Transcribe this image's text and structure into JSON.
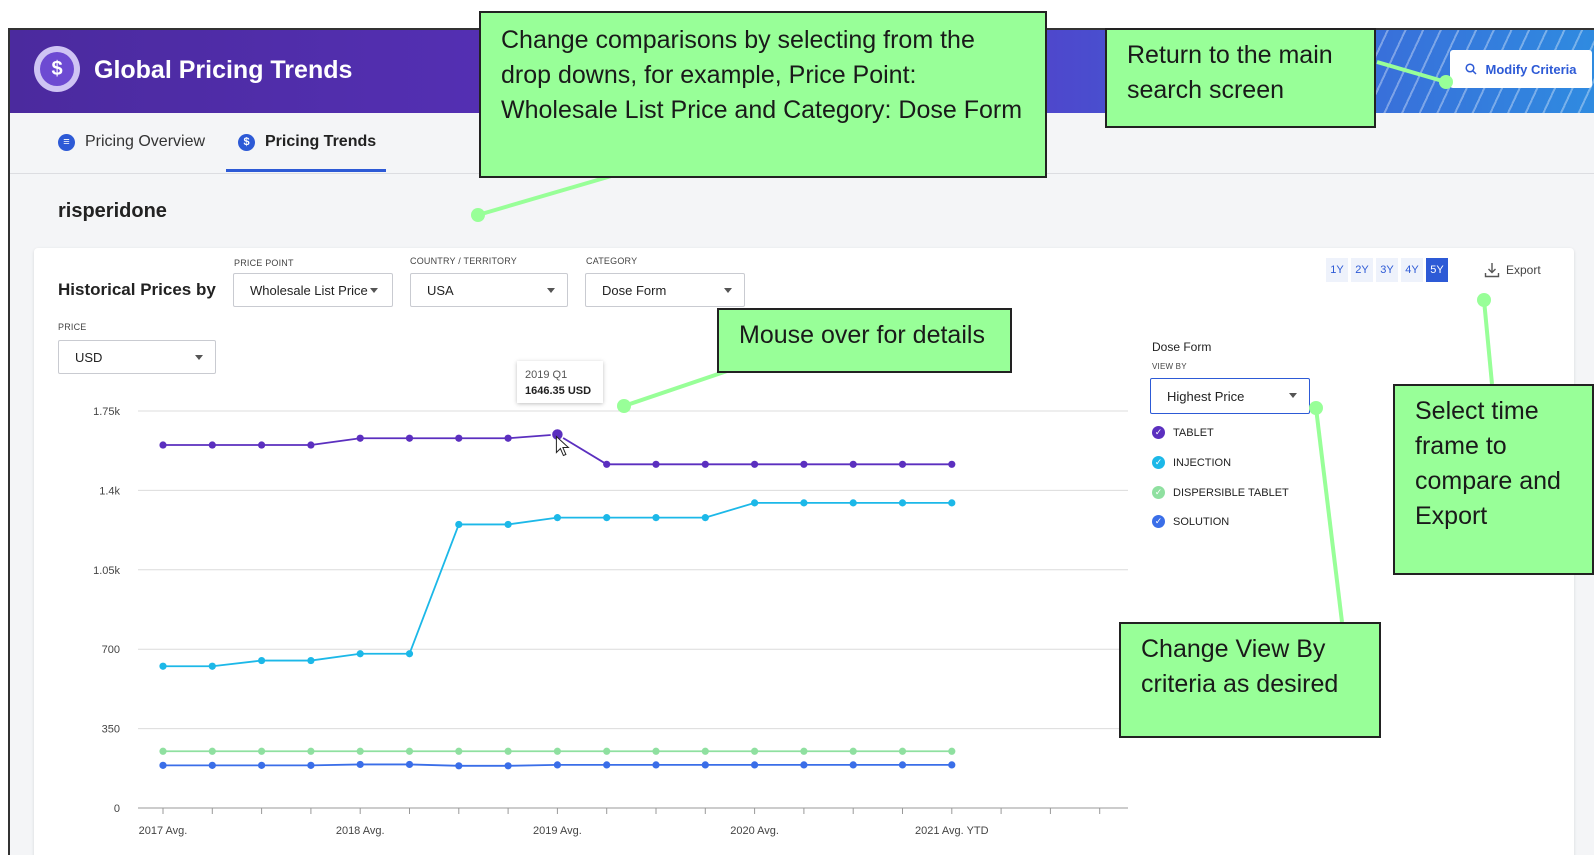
{
  "app": {
    "title": "Global Pricing Trends",
    "logo_icon": "dollar-circle-icon",
    "modify_label": "Modify Criteria"
  },
  "tabs": [
    {
      "label": "Pricing Overview",
      "icon": "overview-icon",
      "active": false
    },
    {
      "label": "Pricing Trends",
      "icon": "dollar-icon",
      "active": true
    }
  ],
  "drug_name": "risperidone",
  "controls": {
    "historical_label": "Historical Prices by",
    "price_point": {
      "label": "PRICE POINT",
      "value": "Wholesale List Price"
    },
    "country": {
      "label": "COUNTRY / TERRITORY",
      "value": "USA"
    },
    "category": {
      "label": "CATEGORY",
      "value": "Dose Form"
    },
    "price": {
      "label": "PRICE",
      "value": "USD"
    }
  },
  "periods": [
    {
      "label": "1Y",
      "active": false
    },
    {
      "label": "2Y",
      "active": false
    },
    {
      "label": "3Y",
      "active": false
    },
    {
      "label": "4Y",
      "active": false
    },
    {
      "label": "5Y",
      "active": true
    }
  ],
  "export_label": "Export",
  "legend": {
    "title": "Dose Form",
    "view_by_label": "VIEW BY",
    "view_by_value": "Highest Price",
    "items": [
      {
        "label": "TABLET",
        "color": "#5b2fbf"
      },
      {
        "label": "INJECTION",
        "color": "#1cb8e8"
      },
      {
        "label": "DISPERSIBLE TABLET",
        "color": "#8fe0a0"
      },
      {
        "label": "SOLUTION",
        "color": "#3a6ee8"
      }
    ]
  },
  "tooltip": {
    "period": "2019 Q1",
    "value": "1646.35 USD"
  },
  "chart_data": {
    "type": "line",
    "x": [
      "2017 Avg.",
      "",
      "",
      "",
      "2018 Avg.",
      "",
      "",
      "",
      "2019 Avg.",
      "",
      "",
      "",
      "2020 Avg.",
      "",
      "",
      "",
      "2021 Avg. YTD"
    ],
    "ylim": [
      0,
      1750
    ],
    "yticks": [
      "0",
      "350",
      "700",
      "1.05k",
      "1.4k",
      "1.75k"
    ],
    "ytick_values": [
      0,
      350,
      700,
      1050,
      1400,
      1750
    ],
    "series": [
      {
        "name": "TABLET",
        "color": "#5b2fbf",
        "values": [
          1600,
          1600,
          1600,
          1600,
          1630,
          1630,
          1630,
          1630,
          1646.35,
          1515,
          1515,
          1515,
          1515,
          1515,
          1515,
          1515,
          1515
        ]
      },
      {
        "name": "INJECTION",
        "color": "#1cb8e8",
        "values": [
          625,
          625,
          650,
          650,
          680,
          680,
          1250,
          1250,
          1280,
          1280,
          1280,
          1280,
          1345,
          1345,
          1345,
          1345,
          1345
        ]
      },
      {
        "name": "DISPERSIBLE TABLET",
        "color": "#8fe0a0",
        "values": [
          250,
          250,
          250,
          250,
          250,
          250,
          250,
          250,
          250,
          250,
          250,
          250,
          250,
          250,
          250,
          250,
          250
        ]
      },
      {
        "name": "SOLUTION",
        "color": "#3a6ee8",
        "values": [
          188,
          188,
          188,
          188,
          192,
          192,
          186,
          186,
          190,
          190,
          190,
          190,
          190,
          190,
          190,
          190,
          190
        ]
      }
    ]
  },
  "callouts": {
    "dropdowns": "Change comparisons by selecting from the drop downs, for example, Price Point: Wholesale List Price and Category: Dose Form",
    "return": "Return to the main search screen",
    "mouse": "Mouse over for details",
    "timeframe": "Select time frame to compare and Export",
    "viewby": "Change View By criteria as desired"
  }
}
